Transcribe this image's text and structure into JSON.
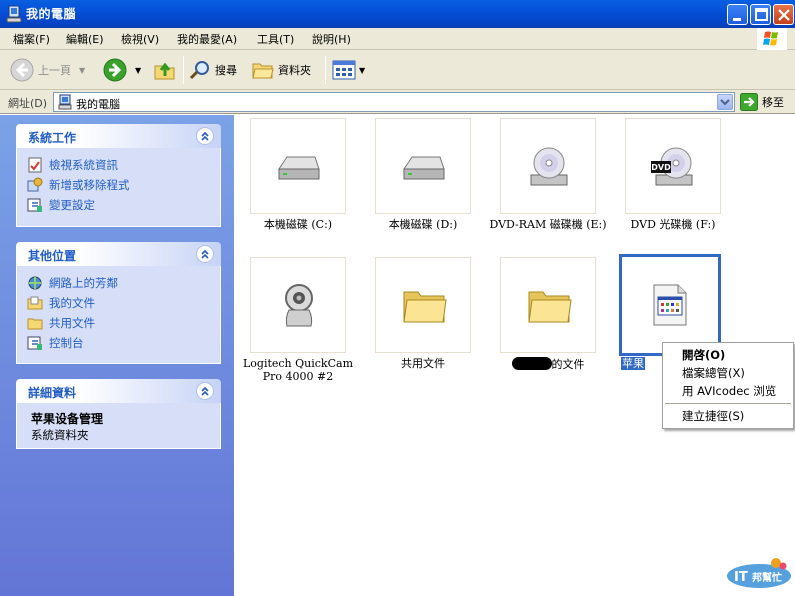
{
  "window": {
    "title": "我的電腦"
  },
  "menu": [
    "檔案(F)",
    "編輯(E)",
    "檢視(V)",
    "我的最愛(A)",
    "工具(T)",
    "說明(H)"
  ],
  "toolbar": {
    "back": "上一頁",
    "search": "搜尋",
    "folders": "資料夾"
  },
  "address": {
    "label": "網址(D)",
    "value": "我的電腦",
    "go": "移至"
  },
  "panels": {
    "system": {
      "title": "系統工作",
      "items": [
        "檢視系統資訊",
        "新增或移除程式",
        "變更設定"
      ]
    },
    "other": {
      "title": "其他位置",
      "items": [
        "網路上的芳鄰",
        "我的文件",
        "共用文件",
        "控制台"
      ]
    },
    "details": {
      "title": "詳細資料",
      "name": "苹果设备管理",
      "type": "系統資料夾"
    }
  },
  "items": [
    {
      "label": "本機磁碟 (C:)",
      "icon": "hard-drive-icon"
    },
    {
      "label": "本機磁碟 (D:)",
      "icon": "hard-drive-icon"
    },
    {
      "label": "DVD-RAM 磁碟機 (E:)",
      "icon": "dvd-ram-drive-icon"
    },
    {
      "label": "DVD 光碟機 (F:)",
      "icon": "dvd-drive-icon"
    },
    {
      "label": "Logitech QuickCam Pro 4000 #2",
      "icon": "webcam-icon"
    },
    {
      "label": "共用文件",
      "icon": "folder-icon"
    },
    {
      "label": "的文件",
      "icon": "folder-icon"
    },
    {
      "label": "苹果",
      "icon": "apple-device-folder-icon"
    }
  ],
  "context_menu": [
    "開啓(O)",
    "檔案總管(X)",
    "用 AVIcodec 浏览",
    "建立捷徑(S)"
  ],
  "watermark": "IT邦幫忙"
}
